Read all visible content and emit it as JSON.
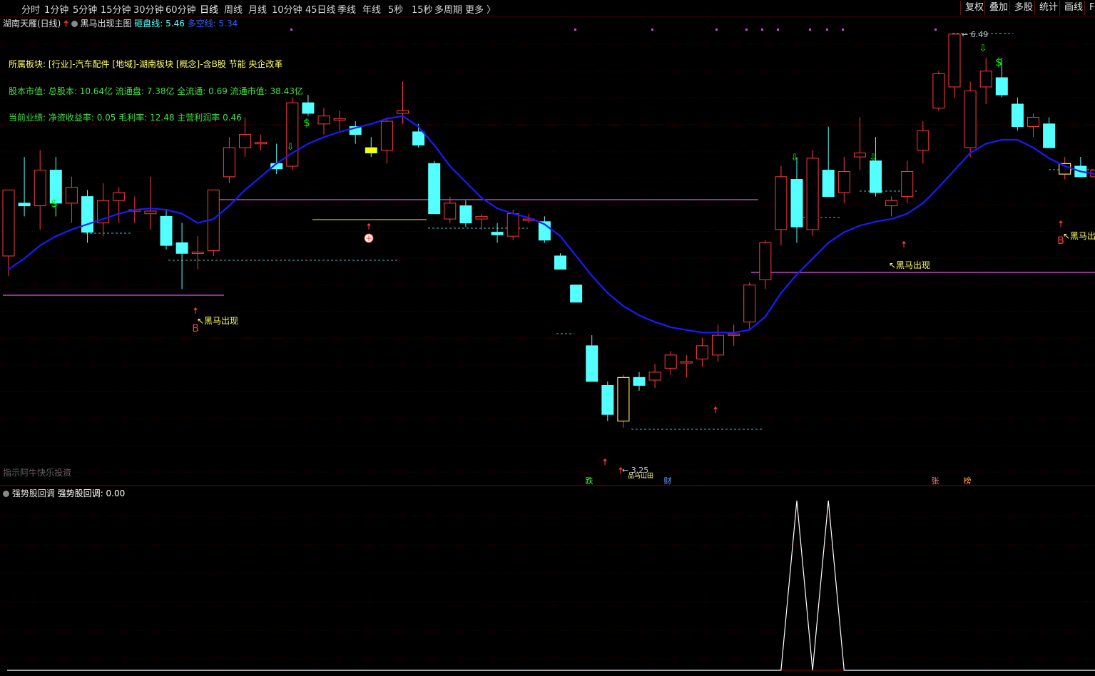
{
  "toolbar": {
    "periods": [
      "分时",
      "1分钟",
      "5分钟",
      "15分钟",
      "30分钟",
      "60分钟",
      "日线",
      "周线",
      "月线",
      "10分钟",
      "45日线",
      "季线",
      "年线",
      "5秒",
      "15秒",
      "多周期",
      "更多"
    ],
    "active_period": "日线",
    "right_buttons": [
      "复权",
      "叠加",
      "多股",
      "统计",
      "画线",
      "F"
    ]
  },
  "main": {
    "stock_name": "湖南天雁(日线)",
    "indicator_name": "黑马出现主图",
    "line1_label": "砸盘线: 5.46",
    "line2_label": "多空线: 5.34",
    "info_sector": "所属板块: [行业]-汽车配件 [地域]-湖南板块 [概念]-含B股 节能 央企改革",
    "info_capital": "股本市值: 总股本: 10.64亿 流通盘: 7.38亿 全流通: 0.69 流通市值: 38.43亿",
    "info_perf": "当前业绩: 净资收益率: 0.05 毛利率: 12.48 主营利润率 0.46",
    "watermark": "指示阿牛快乐投资",
    "price_high_label": "6.49",
    "price_low_label": "3.25",
    "signal_black_horse": "黑马出现",
    "signal_b": "B",
    "signal_dollar": "$",
    "marker_die": "跌",
    "marker_cai": "财",
    "marker_zhang": "张",
    "marker_bang": "榜",
    "marker_misc": "品马山田"
  },
  "sub": {
    "indicator_title": "强势股回调",
    "value_label": "强势股回调: 0.00"
  },
  "colors": {
    "up": "#ff3b3b",
    "down": "#54ffff",
    "ma": "#1a1aff",
    "pressure": "#c040c0",
    "signal_yellow": "#ffff00",
    "signal_green": "#00ff00"
  },
  "chart_data": {
    "type": "candlestick",
    "price_range": [
      3.25,
      6.49
    ],
    "candles": [
      {
        "o": 4.8,
        "h": 5.2,
        "l": 4.65,
        "c": 5.3
      },
      {
        "o": 5.2,
        "h": 5.55,
        "l": 5.1,
        "c": 5.18
      },
      {
        "o": 5.18,
        "h": 5.6,
        "l": 5.0,
        "c": 5.45
      },
      {
        "o": 5.45,
        "h": 5.55,
        "l": 5.1,
        "c": 5.2
      },
      {
        "o": 5.2,
        "h": 5.4,
        "l": 5.05,
        "c": 5.32
      },
      {
        "o": 5.25,
        "h": 5.3,
        "l": 4.9,
        "c": 4.98
      },
      {
        "o": 5.05,
        "h": 5.35,
        "l": 4.95,
        "c": 5.22
      },
      {
        "o": 5.22,
        "h": 5.32,
        "l": 5.05,
        "c": 5.28
      },
      {
        "o": 5.15,
        "h": 5.25,
        "l": 5.05,
        "c": 5.15
      },
      {
        "o": 5.12,
        "h": 5.4,
        "l": 5.0,
        "c": 5.14
      },
      {
        "o": 5.1,
        "h": 5.15,
        "l": 4.85,
        "c": 4.88
      },
      {
        "o": 4.9,
        "h": 5.05,
        "l": 4.55,
        "c": 4.82
      },
      {
        "o": 4.82,
        "h": 4.95,
        "l": 4.7,
        "c": 4.83
      },
      {
        "o": 4.84,
        "h": 5.3,
        "l": 4.8,
        "c": 5.3
      },
      {
        "o": 5.4,
        "h": 5.7,
        "l": 5.35,
        "c": 5.62
      },
      {
        "o": 5.62,
        "h": 5.85,
        "l": 5.55,
        "c": 5.72
      },
      {
        "o": 5.66,
        "h": 5.72,
        "l": 5.6,
        "c": 5.66
      },
      {
        "o": 5.5,
        "h": 5.65,
        "l": 5.42,
        "c": 5.46
      },
      {
        "o": 5.48,
        "h": 6.0,
        "l": 5.45,
        "c": 5.96
      },
      {
        "o": 5.96,
        "h": 6.02,
        "l": 5.86,
        "c": 5.88
      },
      {
        "o": 5.8,
        "h": 5.92,
        "l": 5.72,
        "c": 5.86
      },
      {
        "o": 5.84,
        "h": 5.9,
        "l": 5.75,
        "c": 5.84
      },
      {
        "o": 5.78,
        "h": 5.82,
        "l": 5.65,
        "c": 5.72
      },
      {
        "o": 5.62,
        "h": 5.7,
        "l": 5.55,
        "c": 5.58
      },
      {
        "o": 5.6,
        "h": 5.85,
        "l": 5.5,
        "c": 5.82
      },
      {
        "o": 5.88,
        "h": 6.12,
        "l": 5.8,
        "c": 5.9
      },
      {
        "o": 5.74,
        "h": 5.8,
        "l": 5.62,
        "c": 5.64
      },
      {
        "o": 5.5,
        "h": 5.52,
        "l": 5.15,
        "c": 5.12
      },
      {
        "o": 5.08,
        "h": 5.25,
        "l": 5.05,
        "c": 5.2
      },
      {
        "o": 5.18,
        "h": 5.22,
        "l": 5.02,
        "c": 5.05
      },
      {
        "o": 5.08,
        "h": 5.12,
        "l": 5.0,
        "c": 5.1
      },
      {
        "o": 4.98,
        "h": 5.05,
        "l": 4.9,
        "c": 4.96
      },
      {
        "o": 4.95,
        "h": 5.15,
        "l": 4.92,
        "c": 5.12
      },
      {
        "o": 5.08,
        "h": 5.12,
        "l": 5.05,
        "c": 5.08
      },
      {
        "o": 5.06,
        "h": 5.1,
        "l": 4.9,
        "c": 4.92
      },
      {
        "o": 4.8,
        "h": 4.82,
        "l": 4.7,
        "c": 4.7
      },
      {
        "o": 4.58,
        "h": 4.58,
        "l": 4.45,
        "c": 4.45
      },
      {
        "o": 4.12,
        "h": 4.2,
        "l": 3.85,
        "c": 3.85
      },
      {
        "o": 3.82,
        "h": 3.85,
        "l": 3.55,
        "c": 3.6
      },
      {
        "o": 3.55,
        "h": 3.9,
        "l": 3.5,
        "c": 3.88
      },
      {
        "o": 3.88,
        "h": 3.92,
        "l": 3.78,
        "c": 3.82
      },
      {
        "o": 3.86,
        "h": 3.98,
        "l": 3.8,
        "c": 3.92
      },
      {
        "o": 3.95,
        "h": 4.08,
        "l": 3.9,
        "c": 4.05
      },
      {
        "o": 4.0,
        "h": 4.05,
        "l": 3.88,
        "c": 4.0
      },
      {
        "o": 4.02,
        "h": 4.18,
        "l": 3.96,
        "c": 4.12
      },
      {
        "o": 4.05,
        "h": 4.28,
        "l": 4.0,
        "c": 4.2
      },
      {
        "o": 4.2,
        "h": 4.28,
        "l": 4.12,
        "c": 4.21
      },
      {
        "o": 4.3,
        "h": 4.6,
        "l": 4.25,
        "c": 4.58
      },
      {
        "o": 4.62,
        "h": 4.92,
        "l": 4.55,
        "c": 4.9
      },
      {
        "o": 5.0,
        "h": 5.48,
        "l": 4.88,
        "c": 5.4
      },
      {
        "o": 5.38,
        "h": 5.55,
        "l": 4.9,
        "c": 5.02
      },
      {
        "o": 5.0,
        "h": 5.6,
        "l": 4.95,
        "c": 5.54
      },
      {
        "o": 5.45,
        "h": 5.78,
        "l": 5.25,
        "c": 5.25
      },
      {
        "o": 5.28,
        "h": 5.55,
        "l": 5.2,
        "c": 5.44
      },
      {
        "o": 5.55,
        "h": 5.85,
        "l": 5.45,
        "c": 5.58
      },
      {
        "o": 5.52,
        "h": 5.7,
        "l": 5.25,
        "c": 5.28
      },
      {
        "o": 5.18,
        "h": 5.25,
        "l": 5.1,
        "c": 5.22
      },
      {
        "o": 5.25,
        "h": 5.52,
        "l": 5.2,
        "c": 5.44
      },
      {
        "o": 5.6,
        "h": 5.82,
        "l": 5.5,
        "c": 5.75
      },
      {
        "o": 5.92,
        "h": 6.2,
        "l": 5.9,
        "c": 6.18
      },
      {
        "o": 6.08,
        "h": 6.49,
        "l": 6.0,
        "c": 6.48
      },
      {
        "o": 5.62,
        "h": 6.12,
        "l": 5.55,
        "c": 6.05
      },
      {
        "o": 6.08,
        "h": 6.3,
        "l": 5.95,
        "c": 6.2
      },
      {
        "o": 6.15,
        "h": 6.3,
        "l": 6.0,
        "c": 6.02
      },
      {
        "o": 5.95,
        "h": 6.0,
        "l": 5.75,
        "c": 5.78
      },
      {
        "o": 5.78,
        "h": 5.88,
        "l": 5.7,
        "c": 5.85
      },
      {
        "o": 5.8,
        "h": 5.85,
        "l": 5.62,
        "c": 5.62
      },
      {
        "o": 5.42,
        "h": 5.55,
        "l": 5.38,
        "c": 5.5
      },
      {
        "o": 5.48,
        "h": 5.55,
        "l": 5.4,
        "c": 5.4
      },
      {
        "o": 5.4,
        "h": 5.5,
        "l": 5.35,
        "c": 5.45
      }
    ],
    "ma_line_values": [
      4.7,
      4.78,
      4.88,
      4.95,
      5.0,
      5.04,
      5.08,
      5.12,
      5.15,
      5.16,
      5.15,
      5.12,
      5.05,
      5.08,
      5.18,
      5.3,
      5.4,
      5.5,
      5.58,
      5.65,
      5.7,
      5.74,
      5.77,
      5.8,
      5.84,
      5.86,
      5.78,
      5.64,
      5.48,
      5.36,
      5.24,
      5.16,
      5.12,
      5.09,
      5.04,
      4.95,
      4.8,
      4.65,
      4.52,
      4.42,
      4.35,
      4.3,
      4.26,
      4.24,
      4.22,
      4.22,
      4.22,
      4.24,
      4.34,
      4.52,
      4.66,
      4.78,
      4.9,
      4.98,
      5.03,
      5.06,
      5.08,
      5.12,
      5.2,
      5.32,
      5.45,
      5.58,
      5.65,
      5.68,
      5.68,
      5.62,
      5.54,
      5.48,
      5.44,
      5.42
    ],
    "sub_indicator_values": [
      0,
      0,
      0,
      0,
      0,
      0,
      0,
      0,
      0,
      0,
      0,
      0,
      0,
      0,
      0,
      0,
      0,
      0,
      0,
      0,
      0,
      0,
      0,
      0,
      0,
      0,
      0,
      0,
      0,
      0,
      0,
      0,
      0,
      0,
      0,
      0,
      0,
      0,
      0,
      0,
      0,
      0,
      0,
      0,
      0,
      0,
      0,
      0,
      0,
      0,
      1,
      0,
      1,
      0,
      0,
      0,
      0,
      0,
      0,
      0,
      0,
      0,
      0,
      0,
      0,
      0,
      0,
      0,
      0,
      0
    ]
  }
}
